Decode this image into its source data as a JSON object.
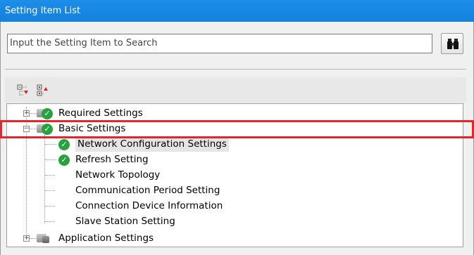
{
  "window": {
    "title": "Setting Item List"
  },
  "search": {
    "placeholder": "Input the Setting Item to Search",
    "button_icon": "binoculars-icon"
  },
  "toolbar": {
    "collapse_icon": "collapse-all-icon",
    "expand_icon": "expand-all-icon"
  },
  "tree": {
    "items": [
      {
        "label": "Required Settings",
        "expanded": false,
        "status": "check"
      },
      {
        "label": "Basic Settings",
        "expanded": true,
        "status": "check",
        "selected": true
      },
      {
        "label": "Network Configuration Settings",
        "status": "check",
        "highlighted": true
      },
      {
        "label": "Refresh Setting",
        "status": "check"
      },
      {
        "label": "Network Topology"
      },
      {
        "label": "Communication Period Setting"
      },
      {
        "label": "Connection Device Information"
      },
      {
        "label": "Slave Station Setting"
      },
      {
        "label": "Application Settings",
        "expanded": false
      }
    ]
  },
  "colors": {
    "title_bar": "#1a88e4",
    "check": "#27a33e",
    "highlight": "#e3262b"
  }
}
